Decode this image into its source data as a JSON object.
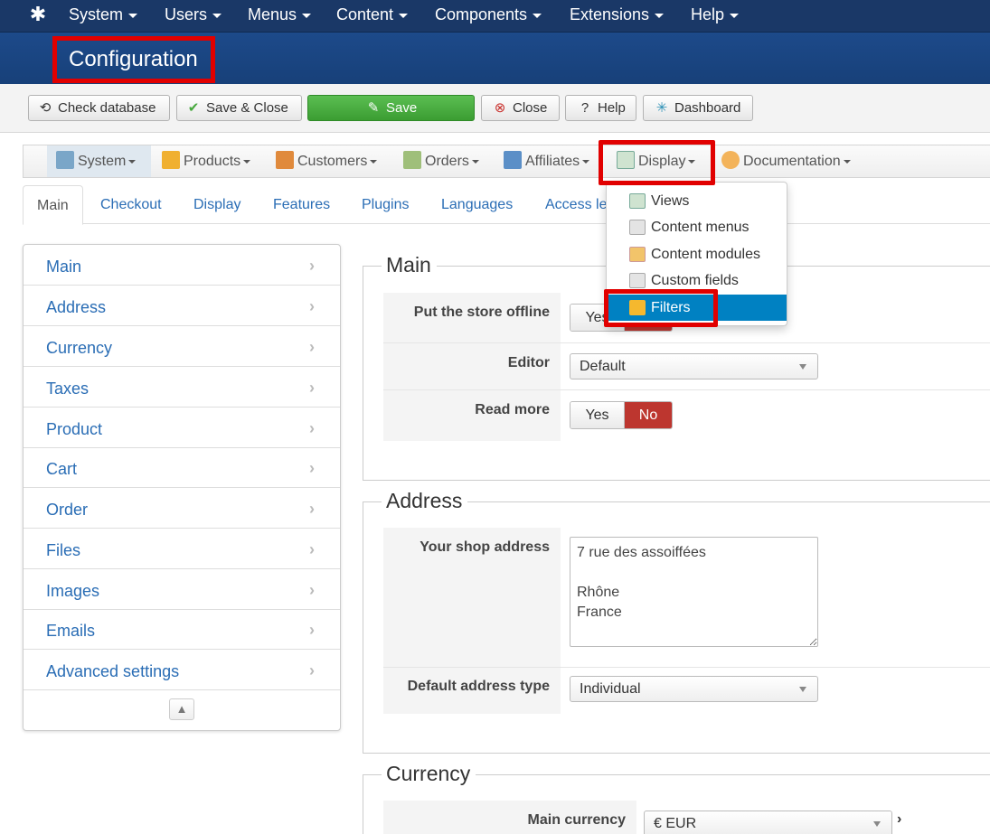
{
  "topnav": {
    "items": [
      "System",
      "Users",
      "Menus",
      "Content",
      "Components",
      "Extensions",
      "Help"
    ]
  },
  "header": {
    "title": "Configuration"
  },
  "toolbar": {
    "check_database": "Check database",
    "save_close": "Save & Close",
    "save": "Save",
    "close": "Close",
    "help": "Help",
    "dashboard": "Dashboard"
  },
  "submenu": {
    "items": [
      "System",
      "Products",
      "Customers",
      "Orders",
      "Affiliates",
      "Display",
      "Documentation"
    ]
  },
  "display_dropdown": {
    "items": [
      "Views",
      "Content menus",
      "Content modules",
      "Custom fields",
      "Filters"
    ],
    "selected": "Filters"
  },
  "tabs": [
    "Main",
    "Checkout",
    "Display",
    "Features",
    "Plugins",
    "Languages",
    "Access le"
  ],
  "sidebar": {
    "items": [
      "Main",
      "Address",
      "Currency",
      "Taxes",
      "Product",
      "Cart",
      "Order",
      "Files",
      "Images",
      "Emails",
      "Advanced settings"
    ]
  },
  "main_section": {
    "legend": "Main",
    "store_offline": {
      "label": "Put the store offline",
      "yes": "Yes",
      "no": "No"
    },
    "editor": {
      "label": "Editor",
      "value": "Default"
    },
    "read_more": {
      "label": "Read more",
      "yes": "Yes",
      "no": "No"
    }
  },
  "address_section": {
    "legend": "Address",
    "shop_address": {
      "label": "Your shop address",
      "value": "7 rue des assoiffées\n\nRhône\nFrance"
    },
    "default_address_type": {
      "label": "Default address type",
      "value": "Individual"
    }
  },
  "currency_section": {
    "legend": "Currency",
    "main_currency": {
      "label": "Main currency",
      "value": "€ EUR"
    }
  },
  "colors": {
    "topnav": "#1a3867",
    "header": "#1d4a8a",
    "highlight": "#e10000",
    "save": "#46a83d",
    "no_active": "#bd362f",
    "link": "#2a6db5"
  }
}
